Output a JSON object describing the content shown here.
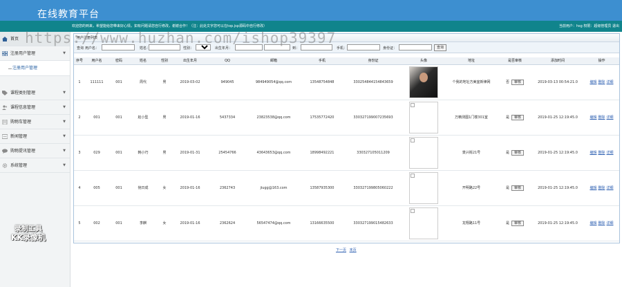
{
  "header": {
    "title": "在线教育平台"
  },
  "subbar": {
    "welcome": "欢迎您的到来，希望能给您带来好心情，如有问题请您自行修改，谢谢合作！（注：此处文字您可以在top.jsp源码中自行修改）",
    "user": "当前用户：hsg 权限：超级管理员 退出"
  },
  "sidebar": {
    "items": [
      {
        "label": "首页",
        "icon": "home-icon"
      },
      {
        "label": "注册用户管理",
        "icon": "grid-icon",
        "expanded": true,
        "children": [
          "注册用户管理"
        ]
      },
      {
        "label": "课程类别管理",
        "icon": "tag-icon"
      },
      {
        "label": "课程信息管理",
        "icon": "users-icon"
      },
      {
        "label": "购物车管理",
        "icon": "doc-icon"
      },
      {
        "label": "新闻管理",
        "icon": "news-icon"
      },
      {
        "label": "购物提讯管理",
        "icon": "chat-icon"
      },
      {
        "label": "系统管理",
        "icon": "gear-icon"
      }
    ]
  },
  "watermark": {
    "line1": "录制工具",
    "line2": "KK录像机"
  },
  "urlmark": "https://www.huzhan.com/ishop39397",
  "panel": {
    "title": "用户注册列表"
  },
  "search": {
    "prefix": "查询",
    "username_label": "用户名：",
    "name_label": "姓名：",
    "gender_label": "性别：",
    "gender_value": "所有",
    "birth_label": "出生年月：",
    "to_label": "到：",
    "phone_label": "手机：",
    "idcard_label": "身份证：",
    "button": "查询"
  },
  "table": {
    "headers": [
      "序号",
      "用户名",
      "密码",
      "姓名",
      "性别",
      "出生年月",
      "QQ",
      "邮箱",
      "手机",
      "身份证",
      "头像",
      "地址",
      "是否审核",
      "添加时间",
      "操作"
    ],
    "rows": [
      {
        "no": "1",
        "username": "111111",
        "password": "001",
        "name": "周代",
        "gender": "男",
        "birth": "2019-03-02",
        "qq": "949045",
        "email": "984949054@qq.com",
        "phone": "13548754848",
        "idcard": "330254844154843659",
        "avatar": "photo",
        "address": "个我的地址方美室新律网",
        "audit": "否",
        "added": "2019-03-13 00:54:21.0"
      },
      {
        "no": "2",
        "username": "001",
        "password": "001",
        "name": "赵小型",
        "gender": "男",
        "birth": "2019-01-16",
        "qq": "5437334",
        "email": "23823538@qq.com",
        "phone": "17535772420",
        "idcard": "330327199007235693",
        "avatar": "broken",
        "address": "万精测图1门楼301室",
        "audit": "是",
        "added": "2019-01-25 12:19:45.0"
      },
      {
        "no": "3",
        "username": "029",
        "password": "001",
        "name": "韩小巧",
        "gender": "男",
        "birth": "2019-01-31",
        "qq": "25454766",
        "email": "43643653@qq.com",
        "phone": "18998492221",
        "idcard": "330327105011209",
        "avatar": "broken",
        "address": "景兴街21号",
        "audit": "是",
        "added": "2019-01-25 12:19:45.0"
      },
      {
        "no": "4",
        "username": "005",
        "password": "001",
        "name": "倪日成",
        "gender": "女",
        "birth": "2019-01-16",
        "qq": "2362743",
        "email": "jiugg@163.com",
        "phone": "13587935300",
        "idcard": "330327199805060222",
        "avatar": "broken",
        "address": "开明路22号",
        "audit": "是",
        "added": "2019-01-25 12:19:45.0"
      },
      {
        "no": "5",
        "username": "002",
        "password": "001",
        "name": "李麒",
        "gender": "女",
        "birth": "2019-01-16",
        "qq": "2362624",
        "email": "56547474@qq.com",
        "phone": "13166635500",
        "idcard": "330327199015482633",
        "avatar": "broken",
        "address": "龙翔路11号",
        "audit": "是",
        "added": "2019-01-25 12:19:45.0"
      }
    ],
    "audit_button": "审核",
    "ops": [
      "编辑",
      "删除",
      "详细"
    ]
  },
  "pager": {
    "next": "下一页",
    "last": "末页"
  },
  "colors": {
    "header": "#3d8fd0",
    "subbar": "#10848c",
    "link": "#2a5db0"
  }
}
